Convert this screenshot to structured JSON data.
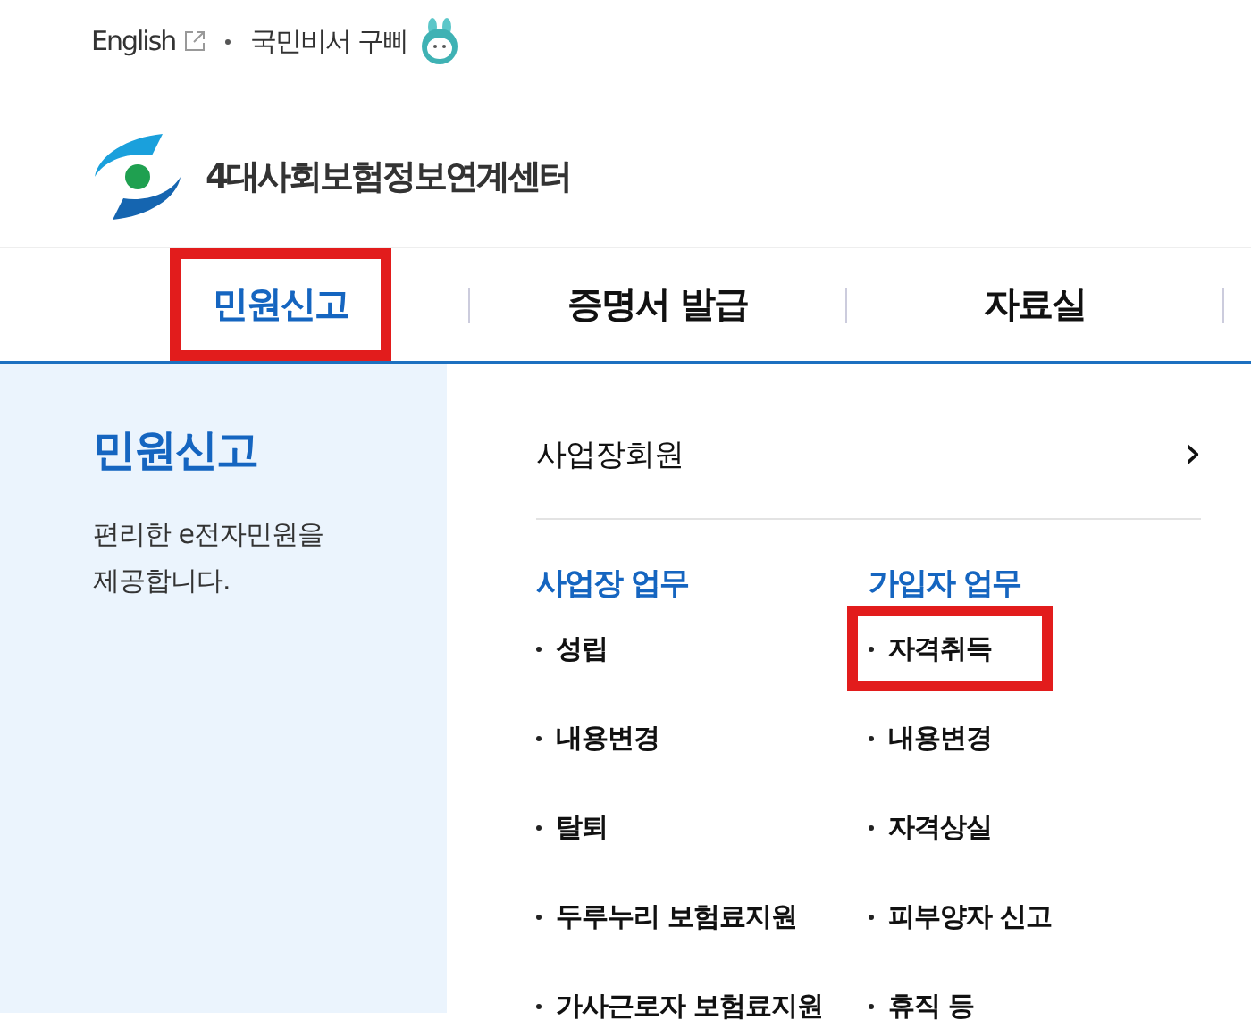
{
  "utility_links": [
    {
      "label": "English",
      "external": true
    },
    {
      "label": "국민비서 구삐",
      "mascot": true
    }
  ],
  "logo": {
    "text": "4대사회보험정보연계센터"
  },
  "nav": [
    {
      "label": "민원신고",
      "selected": true,
      "highlighted": true
    },
    {
      "label": "증명서 발급",
      "selected": false,
      "highlighted": false
    },
    {
      "label": "자료실",
      "selected": false,
      "highlighted": false
    }
  ],
  "sidebar": {
    "title": "민원신고",
    "description": "편리한 e전자민원을\n제공합니다."
  },
  "member_link": {
    "label": "사업장회원",
    "arrow": "›"
  },
  "groups": [
    {
      "title": "사업장 업무",
      "items": [
        {
          "label": "성립",
          "highlighted": false
        },
        {
          "label": "내용변경",
          "highlighted": false
        },
        {
          "label": "탈퇴",
          "highlighted": false
        },
        {
          "label": "두루누리 보험료지원",
          "highlighted": false
        },
        {
          "label": "가사근로자 보험료지원",
          "highlighted": false
        }
      ]
    },
    {
      "title": "가입자 업무",
      "items": [
        {
          "label": "자격취득",
          "highlighted": true
        },
        {
          "label": "내용변경",
          "highlighted": false
        },
        {
          "label": "자격상실",
          "highlighted": false
        },
        {
          "label": "피부양자 신고",
          "highlighted": false
        },
        {
          "label": "휴직 등",
          "highlighted": false
        }
      ]
    }
  ]
}
